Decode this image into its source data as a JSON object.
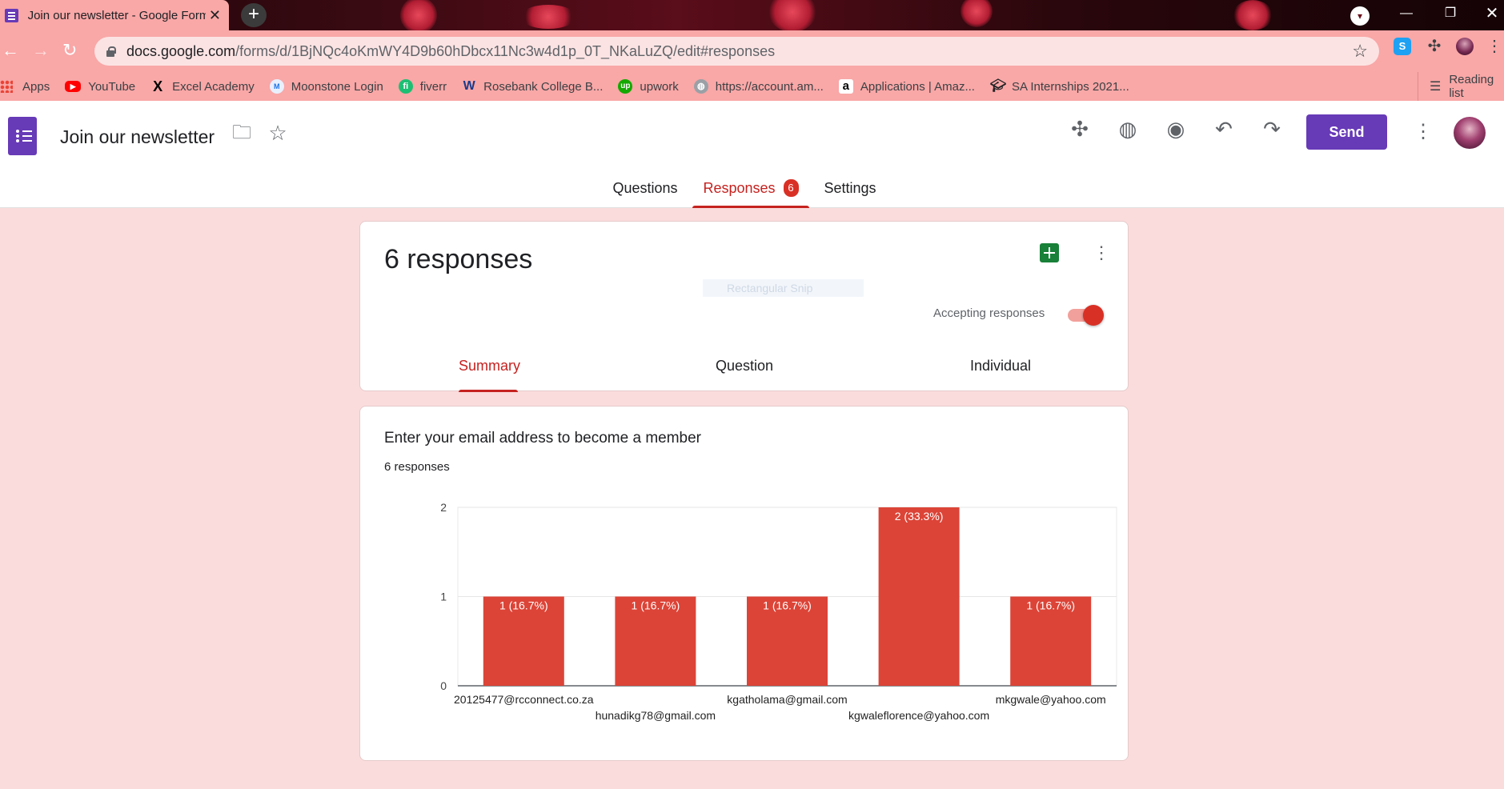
{
  "browser": {
    "tab_title": "Join our newsletter - Google Forms",
    "tab_close": "✕",
    "new_tab": "+",
    "url_host": "docs.google.com",
    "url_path": "/forms/d/1BjNQc4oKmWY4D9b60hDbcx11Nc3w4d1p_0T_NKaLuZQ/edit#responses",
    "bookmarks": [
      {
        "label": "Apps",
        "icon": "apps-grid-icon"
      },
      {
        "label": "YouTube",
        "icon": "youtube-icon",
        "color": "#ff0000"
      },
      {
        "label": "Excel Academy",
        "icon": "x-icon"
      },
      {
        "label": "Moonstone Login",
        "icon": "moonstone-icon"
      },
      {
        "label": "fiverr",
        "icon": "fiverr-icon",
        "color": "#1dbf73"
      },
      {
        "label": "Rosebank College B...",
        "icon": "w-icon"
      },
      {
        "label": "upwork",
        "icon": "upwork-icon",
        "color": "#14a800"
      },
      {
        "label": "https://account.am...",
        "icon": "globe-icon"
      },
      {
        "label": "Applications | Amaz...",
        "icon": "amazon-icon"
      },
      {
        "label": "SA Internships 2021...",
        "icon": "graduation-cap-icon"
      }
    ],
    "reading_list": "Reading list"
  },
  "header": {
    "doc_title": "Join our newsletter",
    "send_label": "Send",
    "tabs": [
      {
        "label": "Questions"
      },
      {
        "label": "Responses",
        "badge": "6"
      },
      {
        "label": "Settings"
      }
    ]
  },
  "summary_card": {
    "count_text": "6 responses",
    "snip_ghost": "Rectangular Snip",
    "accepting_label": "Accepting responses",
    "accepting": true,
    "sub_tabs": [
      "Summary",
      "Question",
      "Individual"
    ]
  },
  "question_card": {
    "title": "Enter your email address to become a member",
    "count": "6 responses"
  },
  "chart_data": {
    "type": "bar",
    "categories": [
      "20125477@rcconnect.co.za",
      "hunadikg78@gmail.com",
      "kgatholama@gmail.com",
      "kgwaleflorence@yahoo.com",
      "mkgwale@yahoo.com"
    ],
    "values": [
      1,
      1,
      1,
      2,
      1
    ],
    "labels": [
      "1 (16.7%)",
      "1 (16.7%)",
      "1 (16.7%)",
      "2 (33.3%)",
      "1 (16.7%)"
    ],
    "ylim": [
      0,
      2
    ],
    "yticks": [
      0,
      1,
      2
    ],
    "bar_color": "#dc4437",
    "grid": true
  },
  "colors": {
    "accent": "#673ab7",
    "active_tab": "#c5221f",
    "background": "#fbdcdc"
  }
}
